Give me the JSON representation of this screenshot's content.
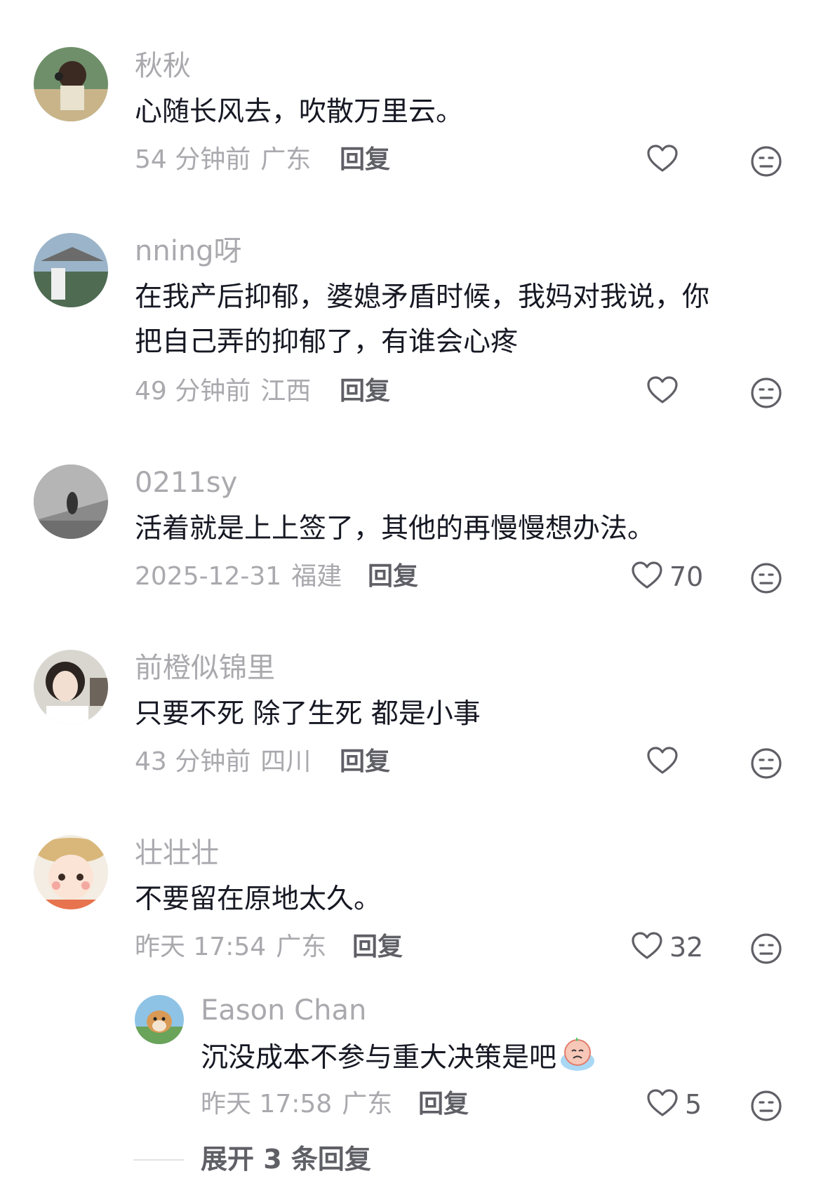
{
  "comments": [
    {
      "username": "秋秋",
      "text": "心随长风去，吹散万里云。",
      "time": "54 分钟前",
      "location": "广东",
      "reply_label": "回复",
      "likes": ""
    },
    {
      "username": "nning呀",
      "text_lines": [
        "在我产后抑郁，婆媳矛盾时候，我妈对我说，你",
        "把自己弄的抑郁了，有谁会心疼"
      ],
      "time": "49 分钟前",
      "location": "江西",
      "reply_label": "回复",
      "likes": ""
    },
    {
      "username": "0211sy",
      "text": "活着就是上上签了，其他的再慢慢想办法。",
      "time": "2025-12-31",
      "location": "福建",
      "reply_label": "回复",
      "likes": "70"
    },
    {
      "username": "前橙似锦里",
      "text": "只要不死 除了生死 都是小事",
      "time": "43 分钟前",
      "location": "四川",
      "reply_label": "回复",
      "likes": ""
    },
    {
      "username": "壮壮壮",
      "text": "不要留在原地太久。",
      "time": "昨天 17:54",
      "location": "广东",
      "reply_label": "回复",
      "likes": "32"
    }
  ],
  "sub_reply": {
    "username": "Eason Chan",
    "text": "沉没成本不参与重大决策是吧",
    "emoji": "crying-emoji",
    "time": "昨天 17:58",
    "location": "广东",
    "reply_label": "回复",
    "likes": "5"
  },
  "expand_label": "展开 3 条回复",
  "colors": {
    "username": "#a9a9ae",
    "text": "#161823",
    "meta": "#a9a9ae",
    "action": "#5f5f66"
  },
  "icons": {
    "like": "heart-outline-icon",
    "dislike": "neutral-face-icon"
  }
}
